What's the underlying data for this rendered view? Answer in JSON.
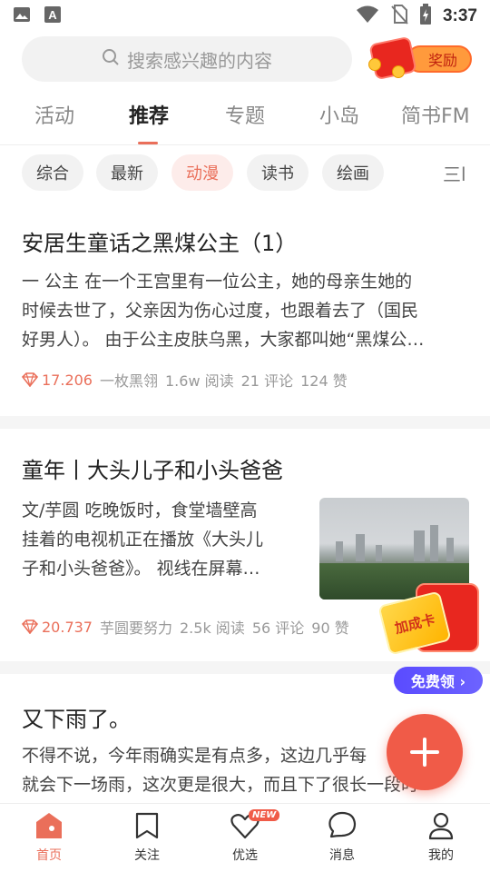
{
  "status_bar": {
    "time": "3:37",
    "icons": [
      "image-icon",
      "font-icon",
      "wifi-icon",
      "no-sim-icon",
      "battery-charging-icon"
    ]
  },
  "search": {
    "placeholder": "搜索感兴趣的内容"
  },
  "reward": {
    "label": "奖励"
  },
  "tabs": [
    {
      "label": "活动"
    },
    {
      "label": "推荐"
    },
    {
      "label": "专题"
    },
    {
      "label": "小岛"
    },
    {
      "label": "简书FM"
    }
  ],
  "active_tab": "推荐",
  "chips": [
    {
      "label": "综合"
    },
    {
      "label": "最新"
    },
    {
      "label": "动漫"
    },
    {
      "label": "读书"
    },
    {
      "label": "绘画"
    }
  ],
  "active_chip": "动漫",
  "more_chip": "三l",
  "articles": [
    {
      "title": "安居生童话之黑煤公主（1）",
      "lines": [
        "一 公主 在一个王宫里有一位公主，她的母亲生她的",
        "时候去世了，父亲因为伤心过度，也跟着去了（国民",
        "好男人）。 由于公主皮肤乌黑，大家都叫她“黑煤公…"
      ],
      "score": "17.206",
      "author": "一枚黑翎",
      "reads": "1.6w 阅读",
      "comments": "21 评论",
      "likes": "124 赞"
    },
    {
      "title": "童年丨大头儿子和小头爸爸",
      "lines": [
        "文/芋圆 吃晚饭时，食堂墙壁高",
        "挂着的电视机正在播放《大头儿",
        "子和小头爸爸》。 视线在屏幕…"
      ],
      "score": "20.737",
      "author": "芋圆要努力",
      "reads": "2.5k 阅读",
      "comments": "56 评论",
      "likes": "90 赞"
    },
    {
      "title": "又下雨了。",
      "lines": [
        "不得不说，今年雨确实是有点多，这边几乎每",
        "就会下一场雨，这次更是很大，而且下了很长一段时"
      ]
    }
  ],
  "promo": {
    "card_label": "加成卡",
    "button_label": "免费领 ›"
  },
  "bottom_nav": [
    {
      "label": "首页",
      "icon": "home-icon",
      "active": true
    },
    {
      "label": "关注",
      "icon": "bookmark-icon"
    },
    {
      "label": "优选",
      "icon": "heart-icon",
      "badge": "NEW"
    },
    {
      "label": "消息",
      "icon": "chat-bubble-icon"
    },
    {
      "label": "我的",
      "icon": "user-icon"
    }
  ],
  "colors": {
    "accent": "#ea6f5a",
    "fab": "#f05b48",
    "promo_button": "#5a4bff"
  }
}
